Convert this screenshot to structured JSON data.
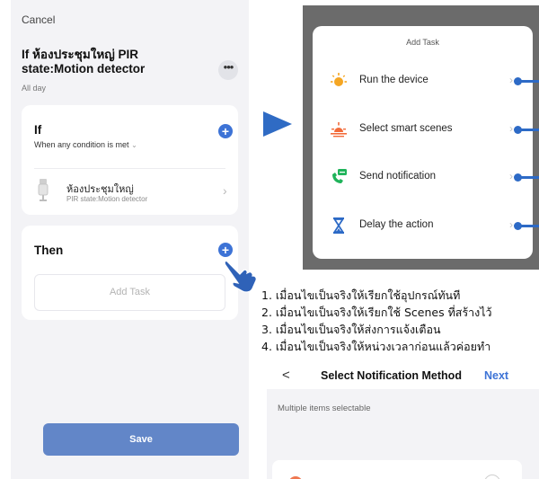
{
  "left_screen": {
    "cancel_label": "Cancel",
    "rule_title": "If ห้องประชุมใหญ่ PIR state:Motion detector",
    "rule_subtitle": "All day",
    "more_label": "•••",
    "if_card": {
      "heading": "If",
      "condition_text": "When any condition is met",
      "condition_caret": "⌄",
      "device": {
        "name": "ห้องประชุมใหญ่",
        "state": "PIR state:Motion detector",
        "icon": "pir-sensor-icon"
      }
    },
    "then_card": {
      "heading": "Then",
      "add_task_label": "Add Task"
    },
    "save_label": "Save",
    "accent_color": "#3d73d6",
    "save_color": "#6286c8"
  },
  "popup": {
    "title": "Add Task",
    "tasks": [
      {
        "label": "Run the device",
        "icon": "sun-device-icon",
        "color": "#f5a623"
      },
      {
        "label": "Select smart scenes",
        "icon": "sunrise-scene-icon",
        "color": "#f26b3a"
      },
      {
        "label": "Send notification",
        "icon": "notification-phone-icon",
        "color": "#1fb35a"
      },
      {
        "label": "Delay the action",
        "icon": "hourglass-icon",
        "color": "#2d6ac6"
      }
    ],
    "callout_color": "#2d6ac6"
  },
  "instructions": [
    "1. เมื่อนไขเป็นจริงให้เรียกใช้อุปกรณ์ทันที",
    "2. เมื่อนไขเป็นจริงให้เรียกใช้ Scenes ที่สร้างไว้",
    "3. เมื่อนไขเป็นจริงให้ส่งการแจ้งเตือน",
    "4. เมื่อนไขเป็นจริงให้หน่วงเวลาก่อนแล้วค่อยทำ"
  ],
  "notification_screen": {
    "back_label": "<",
    "title": "Select Notification Method",
    "next_label": "Next",
    "hint": "Multiple items selectable"
  }
}
